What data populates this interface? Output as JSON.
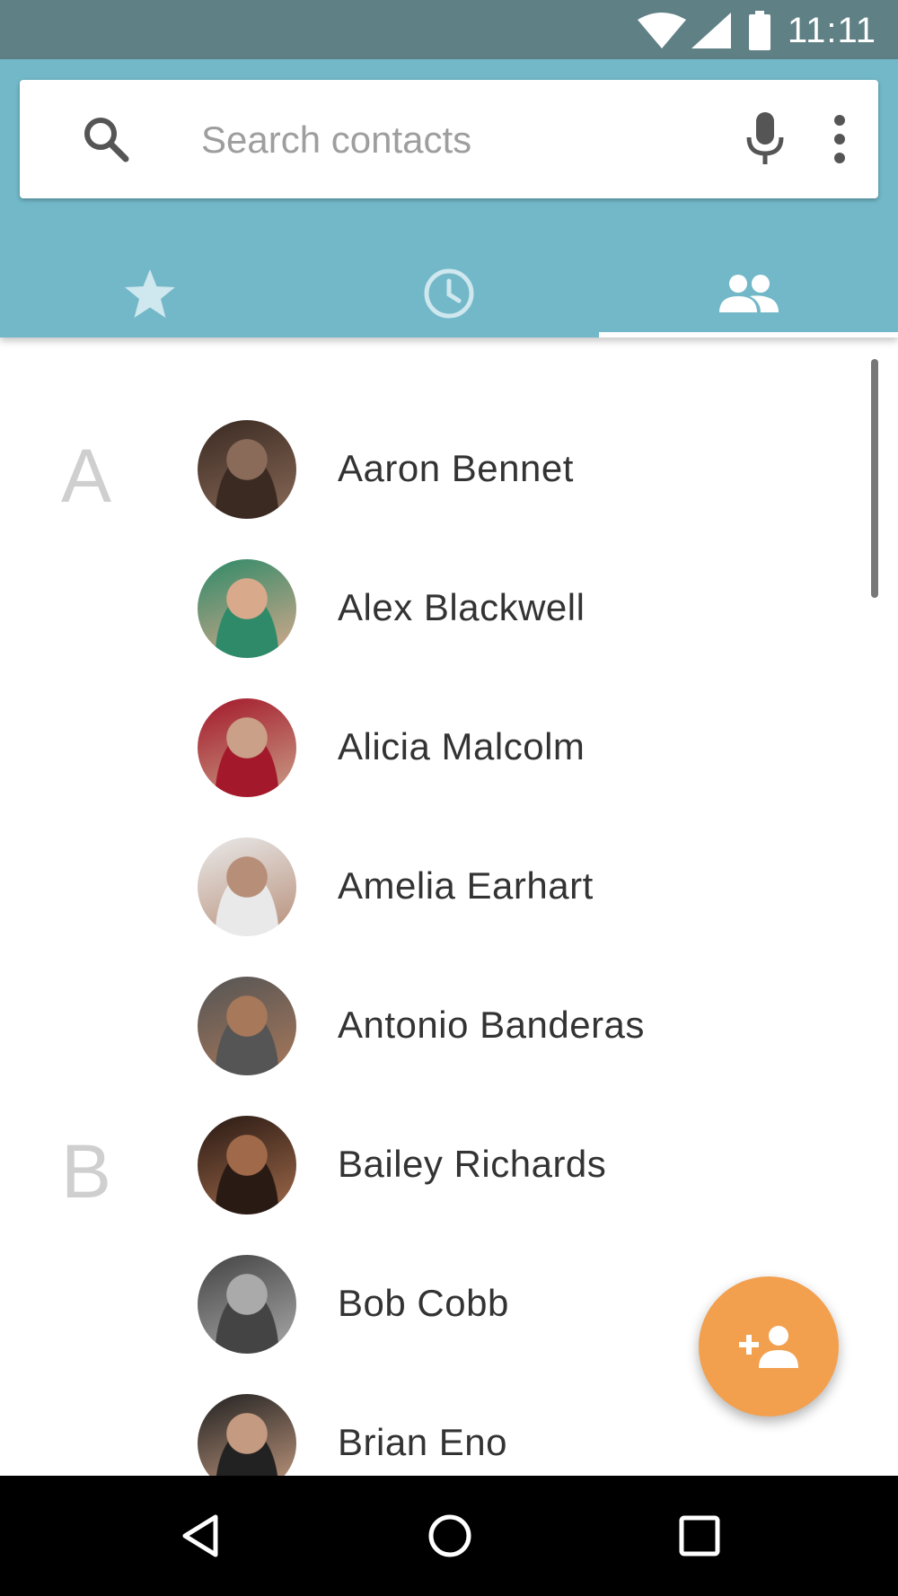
{
  "status_bar": {
    "time": "11:11"
  },
  "search": {
    "placeholder": "Search contacts"
  },
  "tabs": [
    {
      "name": "favorites",
      "icon": "star-icon"
    },
    {
      "name": "recents",
      "icon": "clock-icon"
    },
    {
      "name": "contacts",
      "icon": "people-icon",
      "selected": true
    }
  ],
  "sections": [
    {
      "letter": "A"
    },
    {
      "letter": "B"
    }
  ],
  "contacts": [
    {
      "name": "Aaron Bennet",
      "avatar_colors": [
        "#3a2a22",
        "#8a6a58"
      ]
    },
    {
      "name": "Alex Blackwell",
      "avatar_colors": [
        "#2e8a68",
        "#d9a98c"
      ]
    },
    {
      "name": "Alicia Malcolm",
      "avatar_colors": [
        "#a3182a",
        "#caa088"
      ]
    },
    {
      "name": "Amelia Earhart",
      "avatar_colors": [
        "#e9e9e9",
        "#b78e78"
      ]
    },
    {
      "name": "Antonio Banderas",
      "avatar_colors": [
        "#555555",
        "#a8785a"
      ]
    },
    {
      "name": "Bailey Richards",
      "avatar_colors": [
        "#2a1a14",
        "#a06a4a"
      ]
    },
    {
      "name": "Bob Cobb",
      "avatar_colors": [
        "#444444",
        "#aaaaaa"
      ]
    },
    {
      "name": "Brian Eno",
      "avatar_colors": [
        "#222222",
        "#c49a80"
      ]
    }
  ],
  "colors": {
    "status_bar": "#5f8085",
    "app_bar": "#72b8c8",
    "fab": "#f2a04e",
    "section_letter": "#cfcfcf"
  },
  "fab": {
    "icon": "add-person-icon"
  },
  "nav": [
    "back-icon",
    "home-icon",
    "recents-icon"
  ]
}
